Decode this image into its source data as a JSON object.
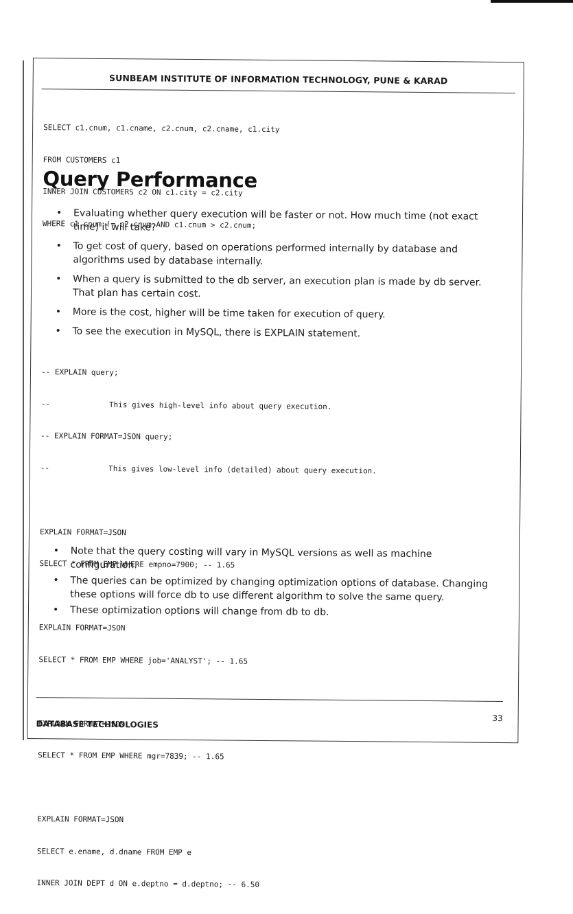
{
  "header": {
    "title": "SUNBEAM INSTITUTE OF INFORMATION TECHNOLOGY, PUNE & KARAD"
  },
  "code_block_1": [
    "SELECT c1.cnum, c1.cname, c2.cnum, c2.cname, c1.city",
    "FROM CUSTOMERS c1",
    "INNER JOIN CUSTOMERS c2 ON c1.city = c2.city",
    "WHERE c1.cnum != c2.cnum AND c1.cnum > c2.cnum;"
  ],
  "section": {
    "heading": "Query Performance"
  },
  "bullets_1": [
    "Evaluating whether query execution will be faster or not. How much time (not exact time) it will take?",
    "To get cost of query, based on operations performed internally by database and algorithms used by database internally.",
    "When a query is submitted to the db server, an execution plan is made by db server. That plan has certain cost.",
    "More is the cost, higher will be time taken for execution of query.",
    "To see the execution in MySQL, there is EXPLAIN statement."
  ],
  "code_block_2": [
    "-- EXPLAIN query;",
    "--             This gives high-level info about query execution.",
    "-- EXPLAIN FORMAT=JSON query;",
    "--             This gives low-level info (detailed) about query execution.",
    "",
    "EXPLAIN FORMAT=JSON",
    "SELECT * FROM EMP WHERE empno=7900; -- 1.65",
    "",
    "EXPLAIN FORMAT=JSON",
    "SELECT * FROM EMP WHERE job='ANALYST'; -- 1.65",
    "",
    "EXPLAIN FORMAT=JSON",
    "SELECT * FROM EMP WHERE mgr=7839; -- 1.65",
    "",
    "EXPLAIN FORMAT=JSON",
    "SELECT e.ename, d.dname FROM EMP e",
    "INNER JOIN DEPT d ON e.deptno = d.deptno; -- 6.50"
  ],
  "bullets_2": [
    "Note that the query costing will vary in MySQL versions as well as machine configuration.",
    "The queries can be optimized by changing optimization options of database. Changing these options will force db to use different algorithm to solve the same query.",
    "These optimization options will change from db to db."
  ],
  "footer": {
    "page_number": "33",
    "course": "DATABASE TECHNOLOGIES"
  },
  "bullet_glyph": "•"
}
